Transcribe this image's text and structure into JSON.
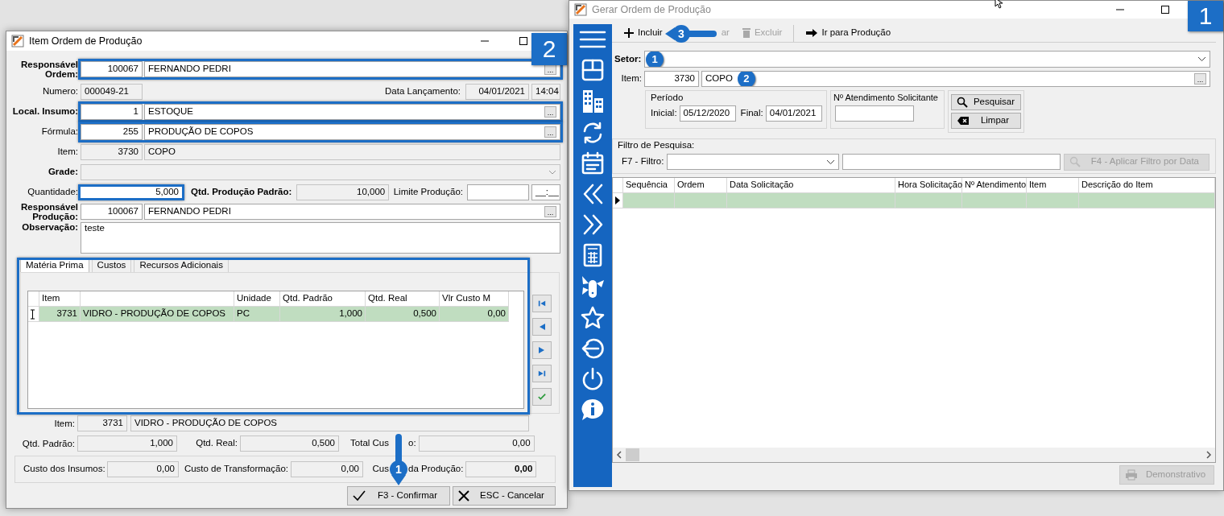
{
  "item_window": {
    "title": "Item Ordem de Produção",
    "badge": "2",
    "responsavel_ordem": {
      "label": "Responsável Ordem:",
      "bold": true,
      "code": "100067",
      "name": "FERNANDO PEDRI",
      "button": "...",
      "disabled": false,
      "highlighted": true
    },
    "numero": {
      "label": "Numero:",
      "value": "000049-21"
    },
    "data_lancamento": {
      "label": "Data Lançamento:",
      "date": "04/01/2021",
      "time": "14:04"
    },
    "local_insumo": {
      "label": "Local. Insumo:",
      "bold": true,
      "code": "1",
      "name": "ESTOQUE",
      "button": "...",
      "disabled": false,
      "highlighted": true
    },
    "formula": {
      "label": "Fórmula:",
      "bold": false,
      "code": "255",
      "name": "PRODUÇÃO DE COPOS",
      "button": "...",
      "disabled": false,
      "highlighted": true
    },
    "item": {
      "label": "Item:",
      "bold": false,
      "code": "3730",
      "name": "COPO",
      "disabled": true,
      "highlighted": false
    },
    "grade": {
      "label": "Grade:",
      "bold": true,
      "disabled": true
    },
    "quantidade": {
      "label": "Quantidade:",
      "value": "5,000",
      "highlighted": true
    },
    "qtd_producao_padrao": {
      "label": "Qtd. Produção Padrão:",
      "value": "10,000"
    },
    "limite_producao": {
      "label": "Limite Produção:",
      "time": "__:__"
    },
    "responsavel_producao": {
      "label": "Responsável Produção:",
      "bold": true,
      "code": "100067",
      "name": "FERNANDO PEDRI",
      "button": "...",
      "disabled": false,
      "highlighted": false
    },
    "observacao": {
      "label": "Observação:",
      "value": "teste"
    },
    "tabs": [
      {
        "label": "Matéria Prima",
        "selected": true
      },
      {
        "label": "Custos",
        "selected": false
      },
      {
        "label": "Recursos Adicionais",
        "selected": false
      }
    ],
    "grid": {
      "highlighted": true,
      "columns": [
        {
          "kind": "code",
          "label": "Item"
        },
        {
          "kind": "description"
        },
        {
          "kind": "unit",
          "label": "Unidade"
        },
        {
          "kind": "number",
          "label": "Qtd. Padrão"
        },
        {
          "kind": "real",
          "label": "Qtd. Real"
        },
        {
          "kind": "cost",
          "label": "Vlr Custo M"
        }
      ],
      "rows": [
        {
          "selected": true,
          "cells": [
            "3731",
            "VIDRO - PRODUÇÃO DE COPOS",
            "PC",
            "1,000",
            "0,500",
            "0,00"
          ]
        }
      ]
    },
    "detail": {
      "item": {
        "label": "Item:",
        "code": "3731",
        "name": "VIDRO - PRODUÇÃO DE COPOS"
      },
      "qtd_padrao": {
        "label": "Qtd. Padrão:",
        "value": "1,000"
      },
      "qtd_real": {
        "label": "Qtd. Real:",
        "value": "0,500"
      },
      "total_custo": {
        "label_parts": [
          "Total Cus",
          "o:"
        ],
        "value": "0,00"
      }
    },
    "totals": {
      "custo_insumos": {
        "label": "Custo dos Insumos:",
        "value": "0,00"
      },
      "custo_transformacao": {
        "label": "Custo de Transformação:",
        "value": "0,00"
      },
      "custo_producao": {
        "label_parts": [
          "Cus",
          "da Produção:"
        ],
        "value": "0,00"
      }
    },
    "buttons": [
      {
        "kind": "confirm",
        "label": "F3 - Confirmar"
      },
      {
        "kind": "cancel",
        "label": "ESC - Cancelar"
      }
    ],
    "callout": {
      "number": "1"
    }
  },
  "order_window": {
    "title": "Gerar Ordem de Produção",
    "badge": "1",
    "toolbar": [
      {
        "kind": "add",
        "label": "Incluir",
        "disabled": false
      },
      {
        "kind": "edit",
        "label": "ar",
        "disabled": true
      },
      {
        "kind": "delete",
        "label": "Excluir",
        "disabled": true
      },
      {
        "kind": "go",
        "label": "Ir para Produção",
        "disabled": false
      }
    ],
    "callout": {
      "number": "3"
    },
    "setor": {
      "label": "Setor:",
      "marker": "1"
    },
    "item": {
      "label": "Item:",
      "code": "3730",
      "name": "COPO",
      "button": "...",
      "marker": "2"
    },
    "periodo": {
      "legend": "Período",
      "inicial_label": "Inicial:",
      "inicial": "05/12/2020",
      "final_label": "Final:",
      "final": "04/01/2021"
    },
    "atendimento": {
      "legend": "Nº Atendimento Solicitante"
    },
    "search_buttons": [
      {
        "kind": "search",
        "label": "Pesquisar"
      },
      {
        "kind": "clear",
        "label": "Limpar"
      }
    ],
    "filtro": {
      "legend": "Filtro de Pesquisa:",
      "label": "F7 - Filtro:",
      "apply_button": {
        "label": "F4 - Aplicar Filtro por Data",
        "disabled": true
      }
    },
    "grid": {
      "columns": [
        "Sequência",
        "Ordem",
        "Data Solicitação",
        "Hora Solicitação",
        "Nº Atendimento",
        "Item",
        "Descrição do Item"
      ],
      "rows": [
        {
          "selected": true
        }
      ]
    },
    "demonstrativo": {
      "label": "Demonstrativo",
      "disabled": true
    }
  }
}
